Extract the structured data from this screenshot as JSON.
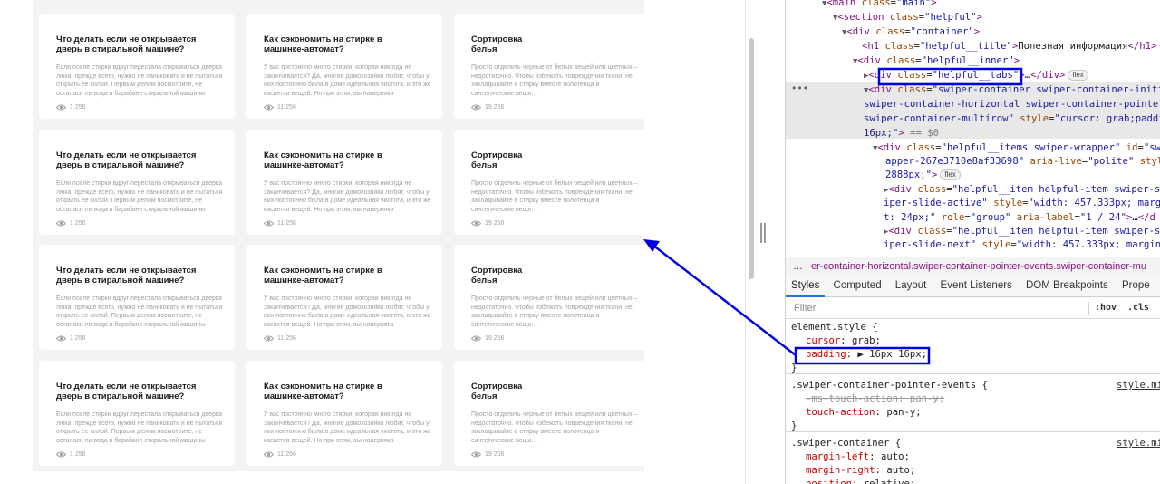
{
  "page": {
    "cards": [
      {
        "title": "Что делать если не открывается\nдверь в стиральной машине?",
        "text": "Если после стирки вдруг перестала открываться дверка люка, прежде всего, нужно не паниковать и не пытаться открыть ее силой. Первым делом посмотрите, не осталась ли вода в барабане стиральной машины",
        "views": "1 256"
      },
      {
        "title": "Как сэкономить на стирке в\nмашинке-автомат?",
        "text": "У вас постоянно много стирки, которая никогда не заканчивается? Да, многие домохозяйки любят, чтобы у них постоянно была в доме идеальная чистота, и это же касается вещей. Но при этом, вы наверняка",
        "views": "11 256"
      },
      {
        "title": "Сортировка\nбелья",
        "text": "Просто отделить черные от белых вещей или цветных – недостаточно. Чтобы избежать повреждения ткани, не закладывайте в стирку вместе полотенца и синтетические вещи…",
        "views": "19 256"
      }
    ]
  },
  "devtools": {
    "dom_lines": [
      {
        "html": "<span class='tri'>▼</span><span class='tag'>&lt;main</span> <span class='attr'>class</span>=<span class='val'>\"main\"</span><span class='tag'>&gt;</span>"
      },
      {
        "html": "<span class='tri'>▼</span><span class='tag'>&lt;section</span> <span class='attr'>class</span>=<span class='val'>\"helpful\"</span><span class='tag'>&gt;</span>"
      },
      {
        "html": "<span class='tri'>▼</span><span class='tag'>&lt;div</span> <span class='attr'>class</span>=<span class='val'>\"container\"</span><span class='tag'>&gt;</span>"
      },
      {
        "html": "<span class='tag'>&lt;h1</span> <span class='attr'>class</span>=<span class='val'>\"helpful__title\"</span><span class='tag'>&gt;</span><span class='txt'>Полезная информация</span><span class='tag'>&lt;/h1&gt;</span>"
      },
      {
        "html": "<span class='tri'>▼</span><span class='tag'>&lt;div</span> <span class='attr'>class</span>=<span class='val'>\"helpful__inner\"</span><span class='tag'>&gt;</span>"
      },
      {
        "html": "<span class='tri'>▶</span><span class='tag'>&lt;div</span> <span class='attr'>class</span>=<span class='val'>\"helpful__tabs\"</span><span class='tag'>&gt;</span>…<span class='tag'>&lt;/div&gt;</span><span class='flex-badge'>flex</span>"
      },
      {
        "html": "<span class='tri'>▼</span><span class='tag'>&lt;div</span> <span class='attr'>class</span>=<span class='val'>\"swiper-container swiper-container-initi</span>"
      },
      {
        "html": "<span class='val'>swiper-container-horizontal swiper-container-pointer-</span>"
      },
      {
        "html": "<span class='val'>swiper-container-multirow\"</span> <span class='attr'>style</span>=<span class='val'>\"cursor: grab;paddin</span>"
      },
      {
        "html": "<span class='val'>16px;\"</span><span class='tag'>&gt;</span> <span style='color:#777'>== $0</span>"
      },
      {
        "html": "<span class='tri'>▼</span><span class='tag'>&lt;div</span> <span class='attr'>class</span>=<span class='val'>\"helpful__items swiper-wrapper\"</span> <span class='attr'>id</span>=<span class='val'>\"sw</span>"
      },
      {
        "html": "<span class='val'>apper-267e3710e8af33698\"</span> <span class='attr'>aria-live</span>=<span class='val'>\"polite\"</span> <span class='attr'>style</span>=<span class='val'>\"</span>"
      },
      {
        "html": "<span class='val'>2888px;\"</span><span class='tag'>&gt;</span><span class='flex-badge'>flex</span>"
      },
      {
        "html": "<span class='tri'>▶</span><span class='tag'>&lt;div</span> <span class='attr'>class</span>=<span class='val'>\"helpful__item helpful-item swiper-sl</span>"
      },
      {
        "html": "<span class='val'>iper-slide-active\"</span> <span class='attr'>style</span>=<span class='val'>\"width: 457.333px; margi</span>"
      },
      {
        "html": "<span class='val'>t: 24px;\"</span> <span class='attr'>role</span>=<span class='val'>\"group\"</span> <span class='attr'>aria-label</span>=<span class='val'>\"1 / 24\"</span><span class='tag'>&gt;</span>…<span class='tag'>&lt;/d</span>"
      },
      {
        "html": "<span class='tri'>▶</span><span class='tag'>&lt;div</span> <span class='attr'>class</span>=<span class='val'>\"helpful__item helpful-item swiper-sl</span>"
      },
      {
        "html": "<span class='val'>iper-slide-next\"</span> <span class='attr'>style</span>=<span class='val'>\"width: 457.333px; margin-</span>"
      }
    ],
    "breadcrumb_prefix": "…",
    "breadcrumb": "er-container-horizontal.swiper-container-pointer-events.swiper-container-mu",
    "tabs": [
      "Styles",
      "Computed",
      "Layout",
      "Event Listeners",
      "DOM Breakpoints",
      "Prope"
    ],
    "filter_placeholder": "Filter",
    "hov": ":hov",
    "cls": ".cls",
    "rules": [
      {
        "selector": "element.style {",
        "source": "",
        "decls": [
          {
            "prop": "cursor",
            "val": "grab;",
            "struck": false
          },
          {
            "prop": "padding",
            "val": "▶ 16px 16px;",
            "struck": false
          }
        ]
      },
      {
        "selector": ".swiper-container-pointer-events {",
        "source": "style.mi",
        "decls": [
          {
            "prop": "-ms-touch-action",
            "val": "pan-y;",
            "struck": true
          },
          {
            "prop": "touch-action",
            "val": "pan-y;",
            "struck": false
          }
        ]
      },
      {
        "selector": ".swiper-container {",
        "source": "style.mi",
        "decls": [
          {
            "prop": "margin-left",
            "val": "auto;",
            "struck": false
          },
          {
            "prop": "margin-right",
            "val": "auto;",
            "struck": false
          },
          {
            "prop": "position",
            "val": "relative;",
            "struck": false
          }
        ]
      }
    ],
    "close_brace": "}"
  },
  "colors": {
    "annotation": "#0000e0",
    "selected_row": "#e8e8e8",
    "tag": "#881280",
    "attr": "#994500",
    "value": "#1a1aa6"
  }
}
